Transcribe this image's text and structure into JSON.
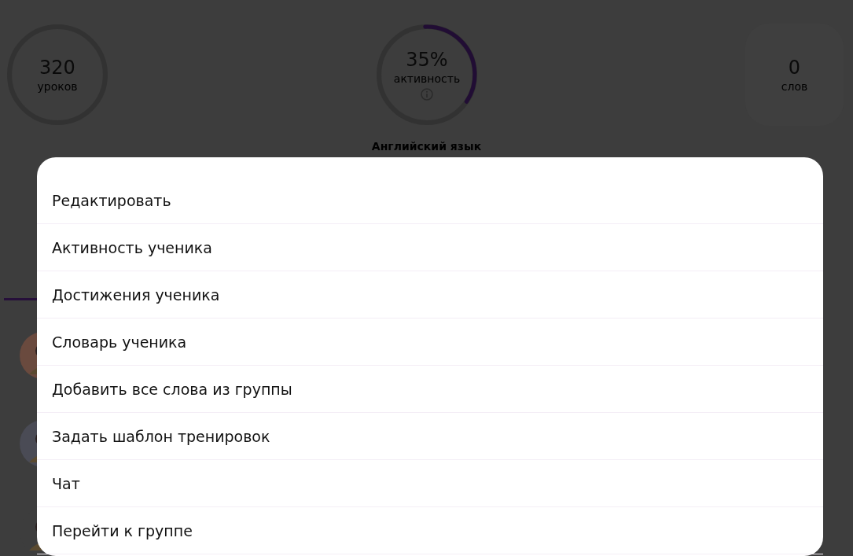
{
  "stats": [
    {
      "kind": "ring",
      "value": "320",
      "label": "уроков"
    },
    {
      "kind": "progress",
      "value": "35%",
      "label": "активность",
      "level": 0.35,
      "info": true
    },
    {
      "kind": "plain",
      "value": "0",
      "label": "слов"
    }
  ],
  "course": "Английский язык",
  "menu": {
    "items": [
      "Редактировать",
      "Активность ученика",
      "Достижения ученика",
      "Словарь ученика",
      "Добавить все слова из группы",
      "Задать шаблон тренировок",
      "Чат",
      "Перейти к группе"
    ]
  }
}
